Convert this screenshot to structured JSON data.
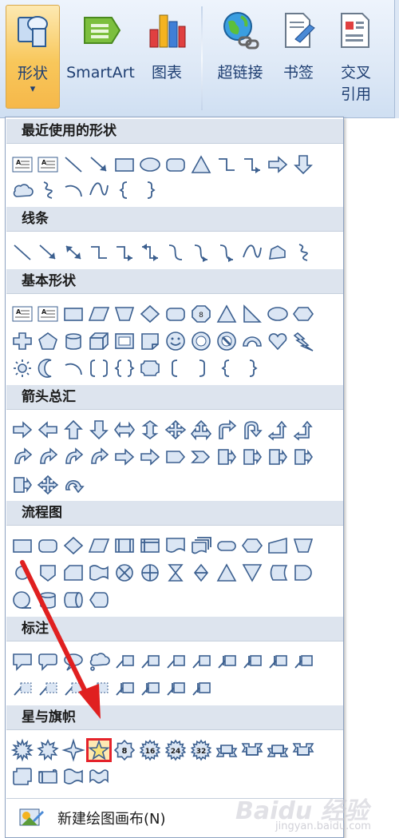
{
  "ribbon": {
    "buttons": [
      {
        "id": "shapes",
        "label": "形状",
        "icon": "shapes-icon",
        "active": true
      },
      {
        "id": "smartart",
        "label": "SmartArt",
        "icon": "smartart-icon"
      },
      {
        "id": "chart",
        "label": "图表",
        "icon": "chart-icon"
      },
      {
        "id": "hyperlink",
        "label": "超链接",
        "icon": "hyperlink-icon"
      },
      {
        "id": "bookmark",
        "label": "书签",
        "icon": "bookmark-icon"
      },
      {
        "id": "crossref",
        "label": "交叉\n引用",
        "icon": "cross-reference-icon"
      }
    ],
    "dropdown_arrow": "▾"
  },
  "menu": {
    "sections": [
      {
        "title": "最近使用的形状",
        "rows": [
          [
            "text-box",
            "vertical-text-box",
            "line",
            "arrow-line",
            "rectangle",
            "oval",
            "rounded-rectangle",
            "triangle",
            "elbow-connector",
            "elbow-arrow-connector",
            "right-arrow",
            "down-arrow"
          ],
          [
            "cloud-shape",
            "freeform-scribble",
            "arc",
            "curve",
            "left-brace",
            "right-brace"
          ]
        ]
      },
      {
        "title": "线条",
        "rows": [
          [
            "line",
            "arrow-line",
            "double-arrow-line",
            "elbow-connector",
            "elbow-arrow-connector",
            "elbow-double-arrow",
            "curved-connector",
            "curved-arrow-connector",
            "curved-double-arrow",
            "curve",
            "freeform",
            "scribble"
          ]
        ]
      },
      {
        "title": "基本形状",
        "rows": [
          [
            "text-box",
            "vertical-text-box",
            "rectangle",
            "parallelogram",
            "trapezoid",
            "diamond",
            "rounded-rectangle",
            "octagon",
            "isosceles-triangle",
            "right-triangle",
            "oval",
            "hexagon"
          ],
          [
            "cross",
            "pentagon",
            "can",
            "cube",
            "bevel",
            "folded-corner",
            "smiley-face",
            "donut",
            "no-symbol",
            "block-arc",
            "heart",
            "lightning-bolt"
          ],
          [
            "sun",
            "moon",
            "arc",
            "double-bracket",
            "double-brace",
            "plaque",
            "left-bracket",
            "right-bracket",
            "left-brace",
            "right-brace"
          ]
        ]
      },
      {
        "title": "箭头总汇",
        "rows": [
          [
            "right-arrow",
            "left-arrow",
            "up-arrow",
            "down-arrow",
            "left-right-arrow",
            "up-down-arrow",
            "quad-arrow",
            "left-right-up-arrow",
            "bent-arrow",
            "u-turn-arrow",
            "left-up-arrow",
            "bent-up-arrow"
          ],
          [
            "curved-right-arrow",
            "curved-left-arrow",
            "curved-up-arrow",
            "curved-down-arrow",
            "striped-right-arrow",
            "notched-right-arrow",
            "pentagon-arrow",
            "chevron",
            "right-arrow-callout",
            "down-arrow-callout",
            "left-arrow-callout",
            "up-arrow-callout"
          ],
          [
            "left-right-arrow-callout",
            "quad-arrow-callout",
            "circular-arrow"
          ]
        ]
      },
      {
        "title": "流程图",
        "rows": [
          [
            "process",
            "alternate-process",
            "decision",
            "data",
            "predefined-process",
            "internal-storage",
            "document",
            "multidocument",
            "terminator",
            "preparation",
            "manual-input",
            "manual-operation"
          ],
          [
            "connector",
            "off-page-connector",
            "card",
            "punched-tape",
            "summing-junction",
            "or",
            "collate",
            "sort",
            "extract",
            "merge",
            "stored-data",
            "delay"
          ],
          [
            "sequential-access-storage",
            "magnetic-disk",
            "direct-access-storage",
            "display"
          ]
        ]
      },
      {
        "title": "标注",
        "rows": [
          [
            "rectangular-callout",
            "rounded-callout",
            "oval-callout",
            "cloud-callout",
            "line-callout-1",
            "line-callout-2",
            "line-callout-3",
            "line-callout-4",
            "line-callout-1-accent",
            "line-callout-2-accent",
            "line-callout-3-accent",
            "line-callout-4-accent"
          ],
          [
            "line-callout-1-no-border",
            "line-callout-2-no-border",
            "line-callout-3-no-border",
            "line-callout-4-no-border",
            "line-callout-1-border-accent",
            "line-callout-2-border-accent",
            "line-callout-3-border-accent",
            "line-callout-4-border-accent"
          ]
        ]
      },
      {
        "title": "星与旗帜",
        "rows": [
          [
            "explosion-1",
            "explosion-2",
            "4-point-star",
            "5-point-star",
            "8-point-star",
            "16-point-star",
            "24-point-star",
            "32-point-star",
            "up-ribbon",
            "down-ribbon",
            "curved-up-ribbon",
            "curved-down-ribbon"
          ],
          [
            "vertical-scroll",
            "horizontal-scroll",
            "wave",
            "double-wave"
          ]
        ]
      }
    ],
    "highlighted_shape": "5-point-star",
    "star_labels": {
      "8": "8",
      "16": "16",
      "24": "24",
      "32": "32"
    },
    "footer": {
      "label": "新建绘图画布(N)",
      "icon": "new-drawing-canvas-icon"
    }
  },
  "watermark": {
    "brand": "Baidu 经验",
    "site": "jingyan.baidu.com"
  },
  "colors": {
    "accent_highlight": "#e5222a",
    "arrow": "#e02020",
    "shape_fill": "#dbe6f4",
    "shape_stroke": "#3b5f8f"
  }
}
